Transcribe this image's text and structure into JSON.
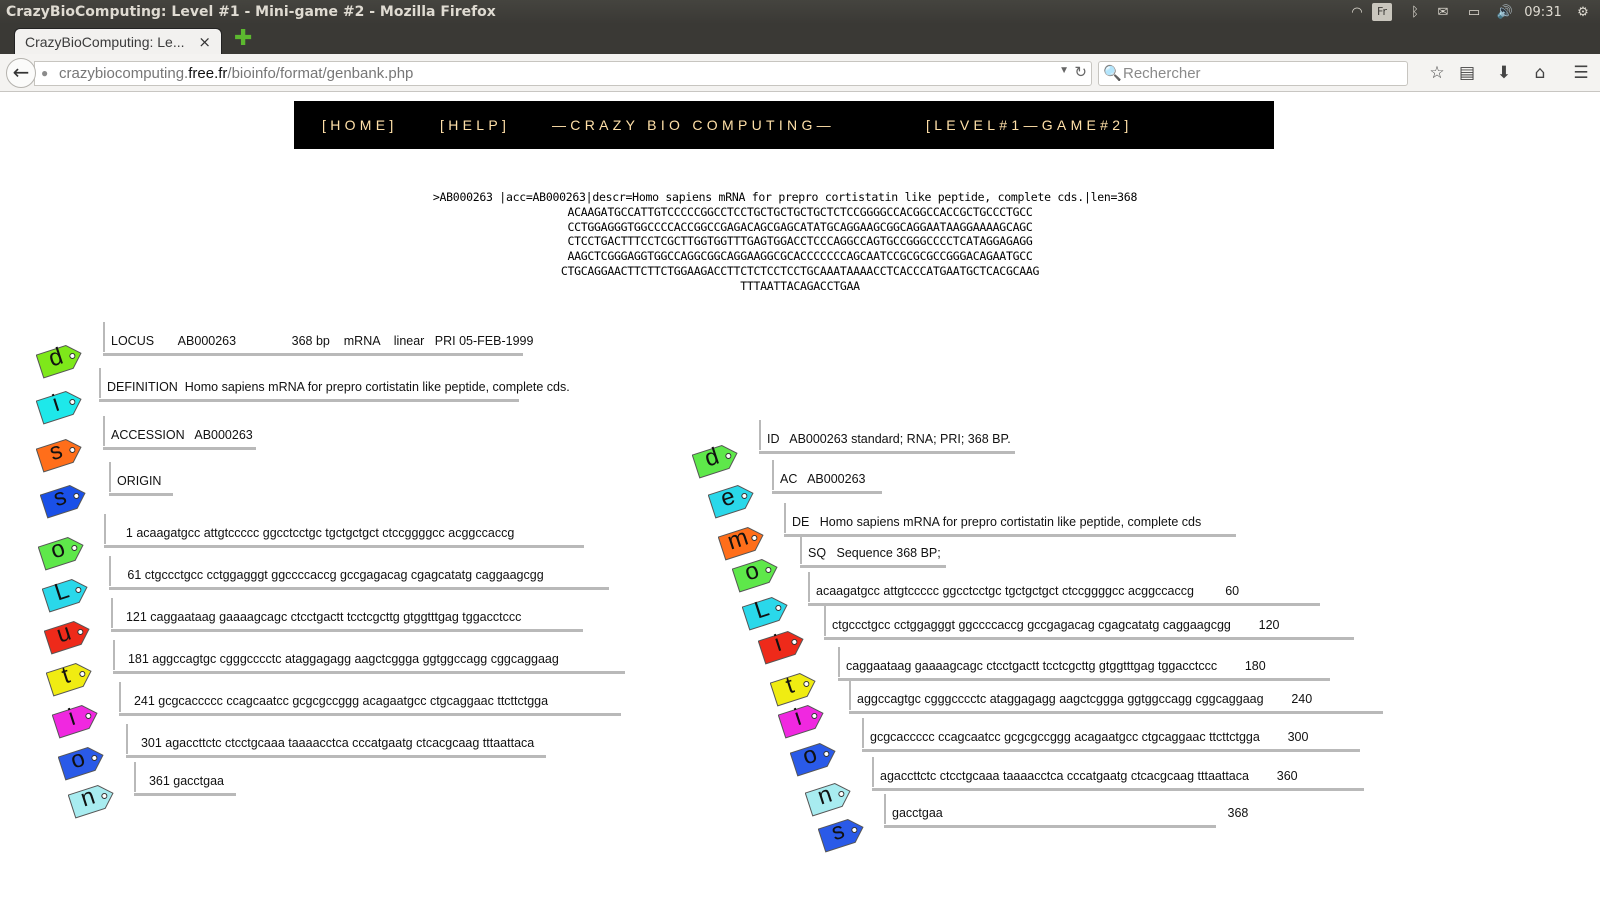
{
  "window": {
    "title": "CrazyBioComputing: Level #1 - Mini-game #2 - Mozilla Firefox",
    "kb": "Fr",
    "clock": "09:31"
  },
  "tab": {
    "label": "CrazyBioComputing: Le...",
    "close": "×"
  },
  "url": {
    "prefix": "crazybiocomputing.",
    "domain": "free.fr",
    "path": "/bioinfo/format/genbank.php"
  },
  "search": {
    "placeholder": "Rechercher"
  },
  "menu": {
    "home": "[HOME]",
    "help": "[HELP]",
    "brand": "—CRAZY BIO COMPUTING—",
    "level": "[LEVEL#1—GAME#2]"
  },
  "fasta": {
    "header": ">AB000263 |acc=AB000263|descr=Homo sapiens mRNA for prepro cortistatin like peptide, complete cds.|len=368",
    "lines": [
      "ACAAGATGCCATTGTCCCCCGGCCTCCTGCTGCTGCTGCTCTCCGGGGCCACGGCCACCGCTGCCCTGCC",
      "CCTGGAGGGTGGCCCCACCGGCCGAGACAGCGAGCATATGCAGGAAGCGGCAGGAATAAGGAAAAGCAGC",
      "CTCCTGACTTTCCTCGCTTGGTGGTTTGAGTGGACCTCCCAGGCCAGTGCCGGGCCCCTCATAGGAGAGG",
      "AAGCTCGGGAGGTGGCCAGGCGGCAGGAAGGCGCACCCCCCCAGCAATCCGCGCGCCGGGACAGAATGCC",
      "CTGCAGGAACTTCTTCTGGAAGACCTTCTCTCCTCCTGCAAATAAAACCTCACCCATGAATGCTCACGCAAG",
      "TTTAATTACAGACCTGAA"
    ]
  },
  "colors": {
    "green": "#7ee81a",
    "cyan": "#1ee8ea",
    "orange": "#ff6e1a",
    "blue": "#1a50e8",
    "lime": "#5ee84a",
    "sky": "#2ad8ea",
    "red": "#ee2a1a",
    "yellow": "#f0ec12",
    "magenta": "#f028e0",
    "royal": "#2a5ae8",
    "pale": "#a8ecf0"
  },
  "left": {
    "letters": [
      "d",
      "i",
      "s",
      "s",
      "o",
      "L",
      "u",
      "t",
      "i",
      "o",
      "n"
    ],
    "lines": [
      "LOCUS       AB000263                368 bp    mRNA    linear   PRI 05-FEB-1999",
      "DEFINITION  Homo sapiens mRNA for prepro cortistatin like peptide, complete cds.",
      "ACCESSION   AB000263",
      "ORIGIN",
      "    1 acaagatgcc attgtccccc ggcctcctgc tgctgctgct ctccggggcc acggccaccg",
      "   61 ctgccctgcc cctggagggt ggccccaccg gccgagacag cgagcatatg caggaagcgg",
      "  121 caggaataag gaaaagcagc ctcctgactt tcctcgcttg gtggtttgag tggacctccc",
      "  181 aggccagtgc cgggcccctc ataggagagg aagctcggga ggtggccagg cggcaggaag",
      "  241 gcgcaccccc ccagcaatcc gcgcgccggg acagaatgcc ctgcaggaac ttcttctgga",
      "  301 agaccttctc ctcctgcaaa taaaacctca cccatgaatg ctcacgcaag tttaattaca",
      "  361 gacctgaa"
    ]
  },
  "right": {
    "letters": [
      "d",
      "e",
      "m",
      "o",
      "L",
      "i",
      "t",
      "i",
      "o",
      "n",
      "s"
    ],
    "lines": [
      "ID   AB000263 standard; RNA; PRI; 368 BP.",
      "AC   AB000263",
      "DE   Homo sapiens mRNA for prepro cortistatin like peptide, complete cds",
      "SQ   Sequence 368 BP;",
      "acaagatgcc attgtccccc ggcctcctgc tgctgctgct ctccggggcc acggccaccg         60",
      "ctgccctgcc cctggagggt ggccccaccg gccgagacag cgagcatatg caggaagcgg        120",
      "caggaataag gaaaagcagc ctcctgactt tcctcgcttg gtggtttgag tggacctccc        180",
      "aggccagtgc cgggcccctc ataggagagg aagctcggga ggtggccagg cggcaggaag        240",
      "gcgcaccccc ccagcaatcc gcgcgccggg acagaatgcc ctgcaggaac ttcttctgga        300",
      "agaccttctc ctcctgcaaa taaaacctca cccatgaatg ctcacgcaag tttaattaca        360",
      "gacctgaa                                                                                  368"
    ]
  }
}
